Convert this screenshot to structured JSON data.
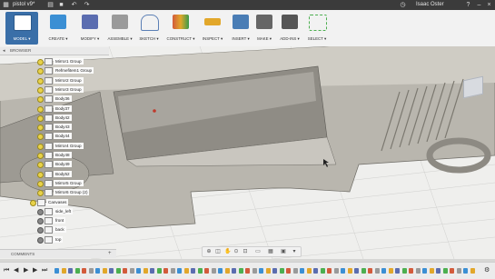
{
  "titlebar": {
    "doc_title": "pistol v9*",
    "user_name": "Isaac Oster"
  },
  "toolbar": {
    "groups": [
      {
        "label": "MODEL ▾",
        "icon": "model-workspace-icon",
        "color": "#ffffff"
      },
      {
        "label": "CREATE ▾",
        "icon": "create-box-icon",
        "color": "#3b8fd4"
      },
      {
        "label": "MODIFY ▾",
        "icon": "modify-press-pull-icon",
        "color": "#5b6db0"
      },
      {
        "label": "ASSEMBLE ▾",
        "icon": "assemble-joint-icon",
        "color": "#9a9a9a"
      },
      {
        "label": "SKETCH ▾",
        "icon": "sketch-arc-icon",
        "color": "#5b7fb5"
      },
      {
        "label": "CONSTRUCT ▾",
        "icon": "construct-plane-icon",
        "color": "#d35b3b"
      },
      {
        "label": "INSPECT ▾",
        "icon": "inspect-measure-icon",
        "color": "#e2a72a"
      },
      {
        "label": "INSERT ▾",
        "icon": "insert-image-icon",
        "color": "#4a7db5"
      },
      {
        "label": "MAKE ▾",
        "icon": "make-3dprint-icon",
        "color": "#666666"
      },
      {
        "label": "ADD-INS ▾",
        "icon": "add-ins-icon",
        "color": "#555555"
      },
      {
        "label": "SELECT ▾",
        "icon": "select-arrow-icon",
        "color": "#4caf50"
      }
    ]
  },
  "browser": {
    "title": "BROWSER",
    "items": [
      {
        "name": "Mirror1 Group",
        "kind": "group"
      },
      {
        "name": "Refmefitem1 Group",
        "kind": "group"
      },
      {
        "name": "Mirror2 Group",
        "kind": "group"
      },
      {
        "name": "Mirror3 Group",
        "kind": "group"
      },
      {
        "name": "Body36",
        "kind": "body"
      },
      {
        "name": "Body37",
        "kind": "body"
      },
      {
        "name": "Body42",
        "kind": "body"
      },
      {
        "name": "Body43",
        "kind": "body"
      },
      {
        "name": "Body44",
        "kind": "body"
      },
      {
        "name": "Mirror4 Group",
        "kind": "group"
      },
      {
        "name": "Body48",
        "kind": "body"
      },
      {
        "name": "Body49",
        "kind": "body"
      },
      {
        "name": "Body52",
        "kind": "body"
      },
      {
        "name": "Mirror5 Group",
        "kind": "group"
      },
      {
        "name": "Mirror6 Group (2)",
        "kind": "group"
      },
      {
        "name": "Canvases",
        "kind": "folder"
      },
      {
        "name": "side_left",
        "kind": "canvas"
      },
      {
        "name": "front",
        "kind": "canvas"
      },
      {
        "name": "back",
        "kind": "canvas"
      },
      {
        "name": "top",
        "kind": "canvas"
      }
    ]
  },
  "comments": {
    "title": "COMMENTS"
  },
  "colors": {
    "accent": "#3a6fa8",
    "titlebar": "#3b3b3b",
    "model_body": "#b9b6ae"
  }
}
